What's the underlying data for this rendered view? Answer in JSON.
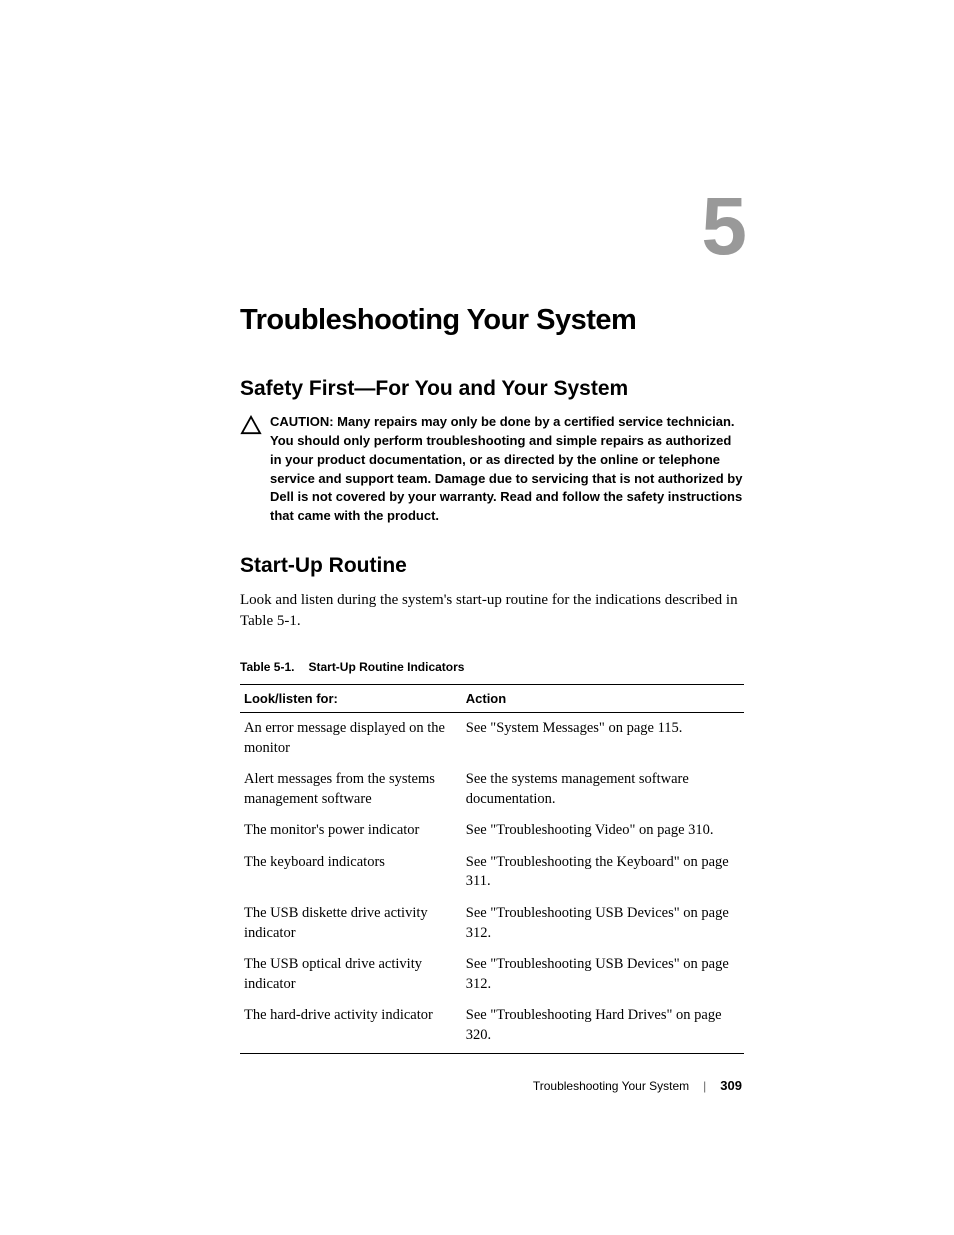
{
  "chapter": {
    "number": "5",
    "title": "Troubleshooting Your System"
  },
  "section1": {
    "heading": "Safety First—For You and Your System"
  },
  "caution": {
    "label": "CAUTION: ",
    "text": "Many repairs may only be done by a certified service technician. You should only perform troubleshooting and simple repairs as authorized in your product documentation, or as directed by the online or telephone service and support team. Damage due to servicing that is not authorized by Dell is not covered by your warranty. Read and follow the safety instructions that came with the product."
  },
  "section2": {
    "heading": "Start-Up Routine",
    "body": "Look and listen during the system's start-up routine for the indications described in Table 5-1."
  },
  "table": {
    "label": "Table 5-1.",
    "title": "Start-Up Routine Indicators",
    "headers": {
      "col1": "Look/listen for:",
      "col2": "Action"
    },
    "rows": [
      {
        "look": "An error message displayed on the monitor",
        "action": "See \"System Messages\" on page 115."
      },
      {
        "look": "Alert messages from the systems management software",
        "action": "See the systems management software documentation."
      },
      {
        "look": "The monitor's power indicator",
        "action": "See \"Troubleshooting Video\" on page 310."
      },
      {
        "look": "The keyboard indicators",
        "action": "See \"Troubleshooting the Keyboard\" on page 311."
      },
      {
        "look": "The USB diskette drive activity indicator",
        "action": "See \"Troubleshooting USB Devices\" on page 312."
      },
      {
        "look": "The USB optical drive activity indicator",
        "action": "See \"Troubleshooting USB Devices\" on page 312."
      },
      {
        "look": "The hard-drive activity indicator",
        "action": "See \"Troubleshooting Hard Drives\" on page 320."
      }
    ]
  },
  "footer": {
    "title": "Troubleshooting Your System",
    "page": "309"
  }
}
